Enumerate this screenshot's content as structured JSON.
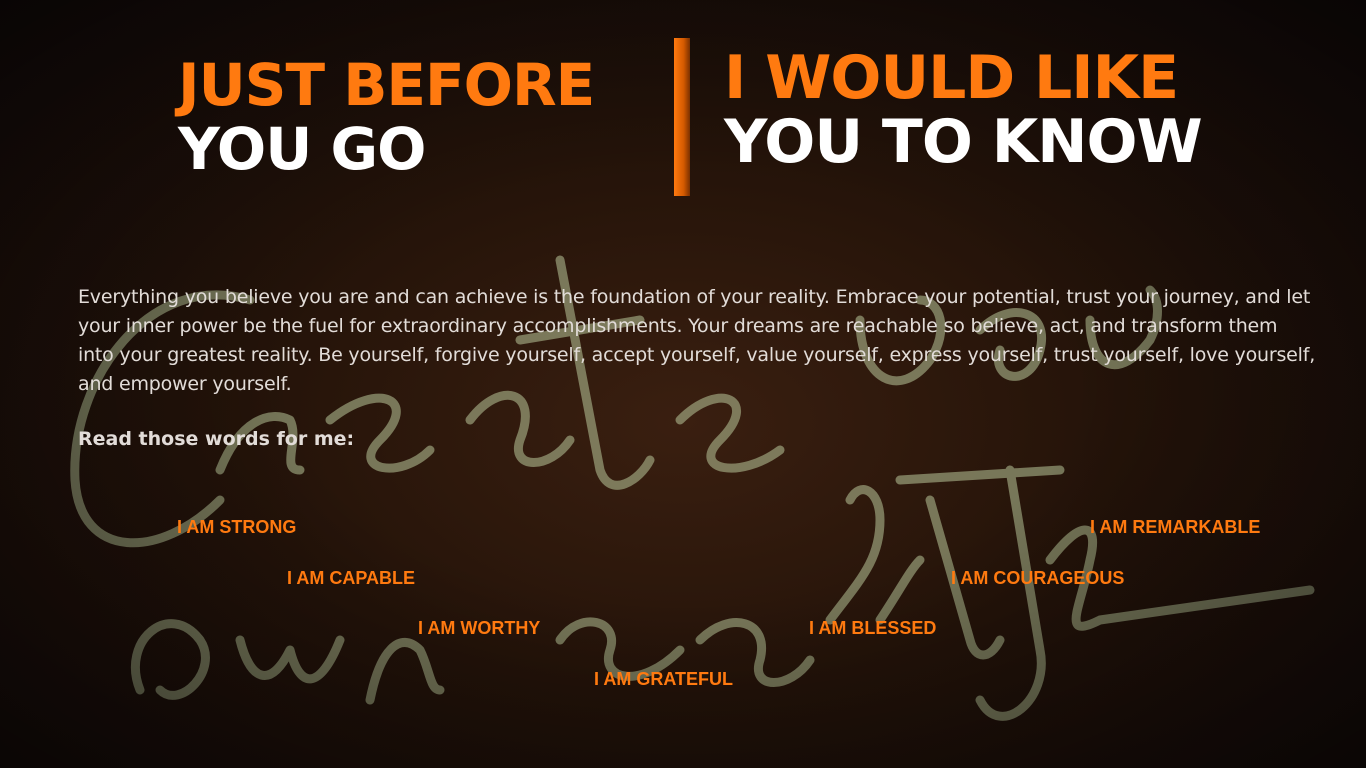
{
  "heading_left": {
    "line1": "JUST BEFORE",
    "line2": "YOU GO"
  },
  "heading_right": {
    "line1": "I WOULD LIKE",
    "line2": "YOU TO KNOW"
  },
  "body": "Everything you believe you are and can achieve is the foundation of your reality. Embrace your potential, trust your journey, and let your inner power be the fuel for extraordinary accomplishments. Your dreams are reachable so believe, act, and transform them into your greatest reality. Be yourself, forgive yourself, accept yourself, value yourself, express yourself, trust yourself, love yourself, and empower yourself.",
  "prompt": "Read those words for me:",
  "affirmations": [
    "I AM STRONG",
    "I AM CAPABLE",
    "I AM WORTHY",
    "I AM GRATEFUL",
    "I AM BLESSED",
    "I AM COURAGEOUS",
    "I AM REMARKABLE"
  ],
  "colors": {
    "accent": "#ff7a10",
    "heading_secondary": "#ffffff",
    "body_text": "#e2dcd8",
    "neon": "#b9c79a"
  }
}
